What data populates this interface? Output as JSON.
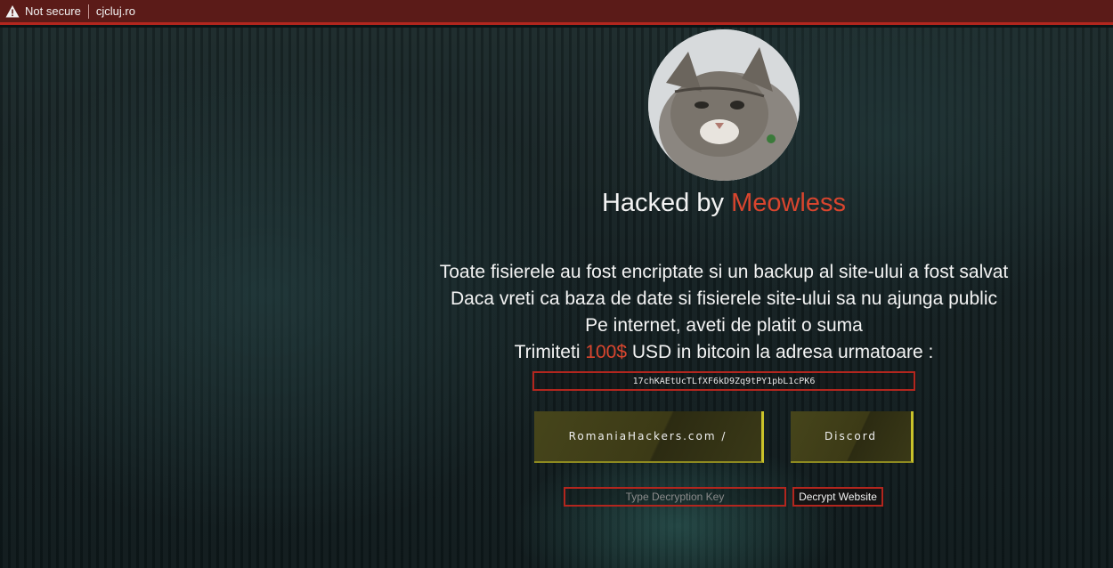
{
  "addressbar": {
    "security_label": "Not secure",
    "url": "cjcluj.ro"
  },
  "header": {
    "title_prefix": "Hacked by ",
    "title_name": "Meowless"
  },
  "message": {
    "line1": "Toate fisierele au fost encriptate si un backup al site-ului a fost salvat",
    "line2": "Daca vreti ca baza de date si fisierele site-ului sa nu ajunga public",
    "line3": "Pe internet, aveti de platit o suma",
    "line4_prefix": "Trimiteti ",
    "line4_amount": "100$",
    "line4_suffix": " USD in bitcoin la adresa urmatoare :"
  },
  "bitcoin_address": "17chKAEtUcTLfXF6kD9Zq9tPY1pbL1cPK6",
  "buttons": {
    "romaniahackers": "RomaniaHackers.com /",
    "discord": "Discord"
  },
  "decrypt": {
    "placeholder": "Type Decryption Key",
    "button_label": "Decrypt Website"
  },
  "colors": {
    "accent_red": "#d9452e",
    "border_red": "#b3261e",
    "button_yellow": "#c9c22a"
  }
}
